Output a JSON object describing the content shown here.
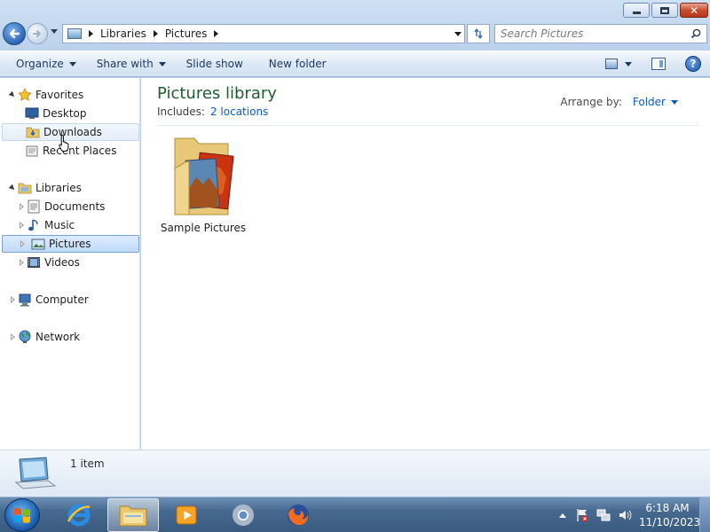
{
  "window": {
    "minimize_label": "Minimize",
    "maximize_label": "Restore",
    "close_label": "Close"
  },
  "address_bar": {
    "breadcrumbs": [
      "Libraries",
      "Pictures"
    ],
    "search_placeholder": "Search Pictures"
  },
  "command_bar": {
    "organize": "Organize",
    "share_with": "Share with",
    "slide_show": "Slide show",
    "new_folder": "New folder"
  },
  "nav_pane": {
    "favorites": "Favorites",
    "desktop": "Desktop",
    "downloads": "Downloads",
    "recent_places": "Recent Places",
    "libraries": "Libraries",
    "documents": "Documents",
    "music": "Music",
    "pictures": "Pictures",
    "videos": "Videos",
    "computer": "Computer",
    "network": "Network"
  },
  "content": {
    "title": "Pictures library",
    "includes_label": "Includes:",
    "includes_link": "2 locations",
    "arrange_label": "Arrange by:",
    "arrange_value": "Folder",
    "items": [
      {
        "label": "Sample Pictures",
        "icon": "folder-with-pictures-icon"
      }
    ]
  },
  "details": {
    "count": "1 item"
  },
  "taskbar": {
    "apps": [
      "internet-explorer",
      "windows-explorer",
      "windows-media-player",
      "chrome",
      "firefox"
    ],
    "active_app": "windows-explorer",
    "time": "6:18 AM",
    "date": "11/10/2023"
  },
  "colors": {
    "title_green": "#1e5d2e",
    "link_blue": "#0d5cb6",
    "selection": "#c1dbfc"
  }
}
